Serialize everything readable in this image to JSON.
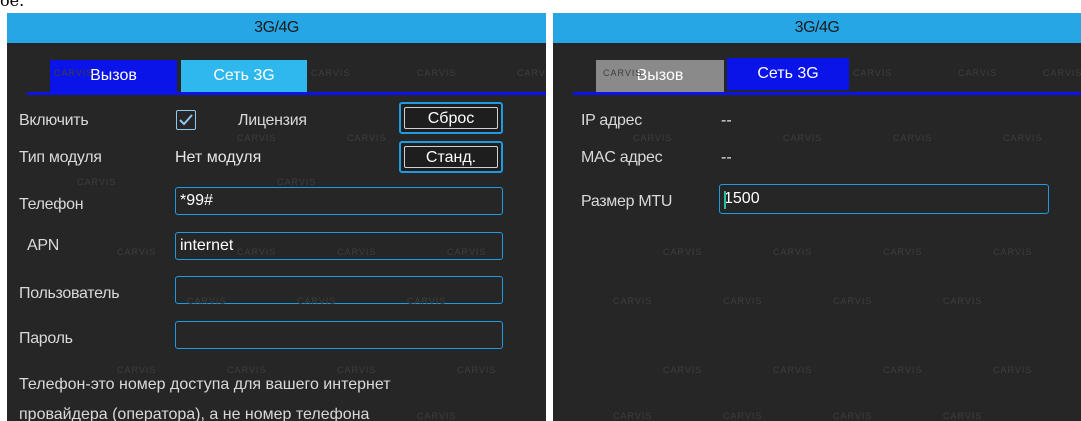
{
  "top_fragment": "ое.",
  "left_panel": {
    "title": "3G/4G",
    "tabs": [
      {
        "label": "Вызов",
        "active": true
      },
      {
        "label": "Сеть 3G",
        "active": false
      }
    ],
    "enable_label": "Включить",
    "enable_checked": true,
    "license_label": "Лицензия",
    "reset_button": "Сброс",
    "module_type_label": "Тип модуля",
    "module_type_value": "Нет модуля",
    "default_button": "Станд.",
    "phone_label": "Телефон",
    "phone_value": "*99#",
    "apn_label": "APN",
    "apn_value": "internet",
    "user_label": "Пользователь",
    "user_value": "",
    "password_label": "Пароль",
    "password_value": "",
    "note_line1": "Телефон-это номер доступа для вашего интернет",
    "note_line2": "провайдера (оператора), а не номер телефона"
  },
  "right_panel": {
    "title": "3G/4G",
    "tabs": [
      {
        "label": "Вызов",
        "active": false
      },
      {
        "label": "Сеть 3G",
        "active": true
      }
    ],
    "ip_label": "IP адрес",
    "ip_value": "--",
    "mac_label": "MAC адрес",
    "mac_value": "--",
    "mtu_label": "Размер MTU",
    "mtu_value": "1500"
  },
  "watermark": "CARVIS",
  "colors": {
    "panel_bg": "#262626",
    "title_bar": "#27a6e5",
    "tab_active_blue": "#0b14e8",
    "tab_light_blue": "#2eb8ee",
    "tab_inactive_gray": "#8a8a8a",
    "input_border": "#1f9be0"
  }
}
